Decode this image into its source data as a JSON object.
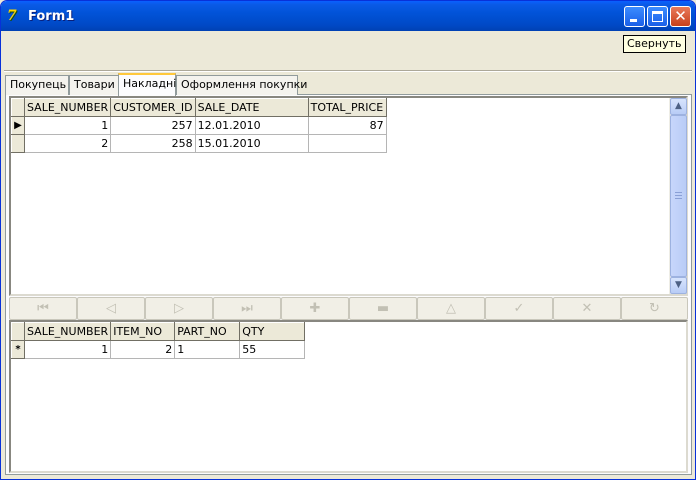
{
  "window": {
    "title": "Form1",
    "tooltip": "Свернуть"
  },
  "tabs": [
    {
      "label": "Покупець",
      "active": false
    },
    {
      "label": "Товари",
      "active": false
    },
    {
      "label": "Накладні",
      "active": true
    },
    {
      "label": "Оформлення покупки",
      "active": false
    }
  ],
  "master_grid": {
    "columns": [
      "SALE_NUMBER",
      "CUSTOMER_ID",
      "SALE_DATE",
      "TOTAL_PRICE"
    ],
    "rows": [
      {
        "indicator": "▶",
        "sale_number": "1",
        "customer_id": "257",
        "sale_date": "12.01.2010",
        "total_price": "87"
      },
      {
        "indicator": "",
        "sale_number": "2",
        "customer_id": "258",
        "sale_date": "15.01.2010",
        "total_price": ""
      }
    ]
  },
  "navigator": {
    "buttons": [
      {
        "name": "first",
        "icon": "first-record-icon",
        "glyph": "⏮"
      },
      {
        "name": "prior",
        "icon": "prior-record-icon",
        "glyph": "◁"
      },
      {
        "name": "next",
        "icon": "next-record-icon",
        "glyph": "▷"
      },
      {
        "name": "last",
        "icon": "last-record-icon",
        "glyph": "⏭"
      },
      {
        "name": "insert",
        "icon": "insert-record-icon",
        "glyph": "✚"
      },
      {
        "name": "delete",
        "icon": "delete-record-icon",
        "glyph": "▬"
      },
      {
        "name": "edit",
        "icon": "edit-record-icon",
        "glyph": "△"
      },
      {
        "name": "post",
        "icon": "post-edit-icon",
        "glyph": "✓"
      },
      {
        "name": "cancel",
        "icon": "cancel-edit-icon",
        "glyph": "✕"
      },
      {
        "name": "refresh",
        "icon": "refresh-data-icon",
        "glyph": "↻"
      }
    ],
    "enabled": false
  },
  "detail_grid": {
    "columns": [
      "SALE_NUMBER",
      "ITEM_NO",
      "PART_NO",
      "QTY"
    ],
    "rows": [
      {
        "indicator": "*",
        "sale_number": "1",
        "item_no": "2",
        "part_no": "1",
        "qty": "55"
      }
    ]
  },
  "colors": {
    "titlebar": "#0153d8",
    "close_button": "#c8401b",
    "tooltip_bg": "#ffffe1",
    "active_tab_highlight": "#ffc83c"
  }
}
